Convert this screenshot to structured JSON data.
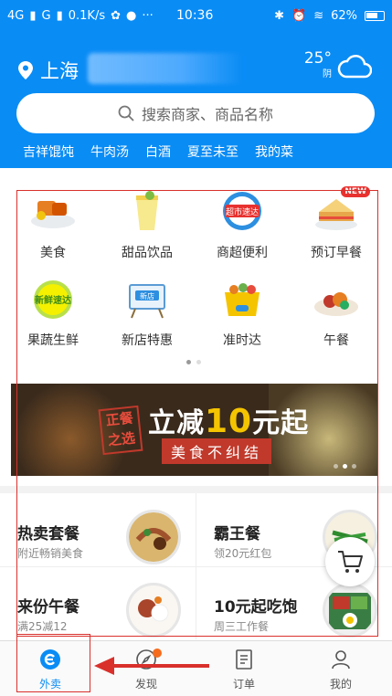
{
  "status_bar": {
    "network_left": "4G",
    "network_right": "G",
    "speed": "0.1K/s",
    "more": "···",
    "time": "10:36",
    "battery": "62%"
  },
  "header": {
    "city": "上海",
    "temperature": "25°",
    "weather": "阴",
    "search_placeholder": "搜索商家、商品名称",
    "hot_words": [
      "吉祥馄饨",
      "牛肉汤",
      "白酒",
      "夏至未至",
      "我的菜"
    ]
  },
  "categories": [
    {
      "label": "美食",
      "icon": "food-icon"
    },
    {
      "label": "甜品饮品",
      "icon": "drink-icon"
    },
    {
      "label": "商超便利",
      "icon": "supermarket-icon"
    },
    {
      "label": "预订早餐",
      "icon": "breakfast-icon",
      "badge": "NEW"
    },
    {
      "label": "果蔬生鲜",
      "icon": "fresh-icon"
    },
    {
      "label": "新店特惠",
      "icon": "new-store-icon"
    },
    {
      "label": "准时达",
      "icon": "on-time-icon"
    },
    {
      "label": "午餐",
      "icon": "lunch-icon"
    }
  ],
  "banner": {
    "stamp": "正餐之选",
    "headline_pre": "立减",
    "headline_num": "10",
    "headline_post": "元起",
    "tagline": "美食不纠结"
  },
  "deals": [
    {
      "title": "热卖套餐",
      "sub": "附近畅销美食"
    },
    {
      "title": "霸王餐",
      "sub": "领20元红包"
    },
    {
      "title": "来份午餐",
      "sub": "满25减12"
    },
    {
      "title": "10元起吃饱",
      "sub": "周三工作餐"
    }
  ],
  "tabs": [
    {
      "label": "外卖",
      "icon": "takeout-icon",
      "active": true
    },
    {
      "label": "发现",
      "icon": "discover-icon"
    },
    {
      "label": "订单",
      "icon": "orders-icon"
    },
    {
      "label": "我的",
      "icon": "profile-icon"
    }
  ],
  "colors": {
    "brand": "#0a8cf5",
    "annotation": "#d9302c",
    "badge": "#e8322f"
  }
}
